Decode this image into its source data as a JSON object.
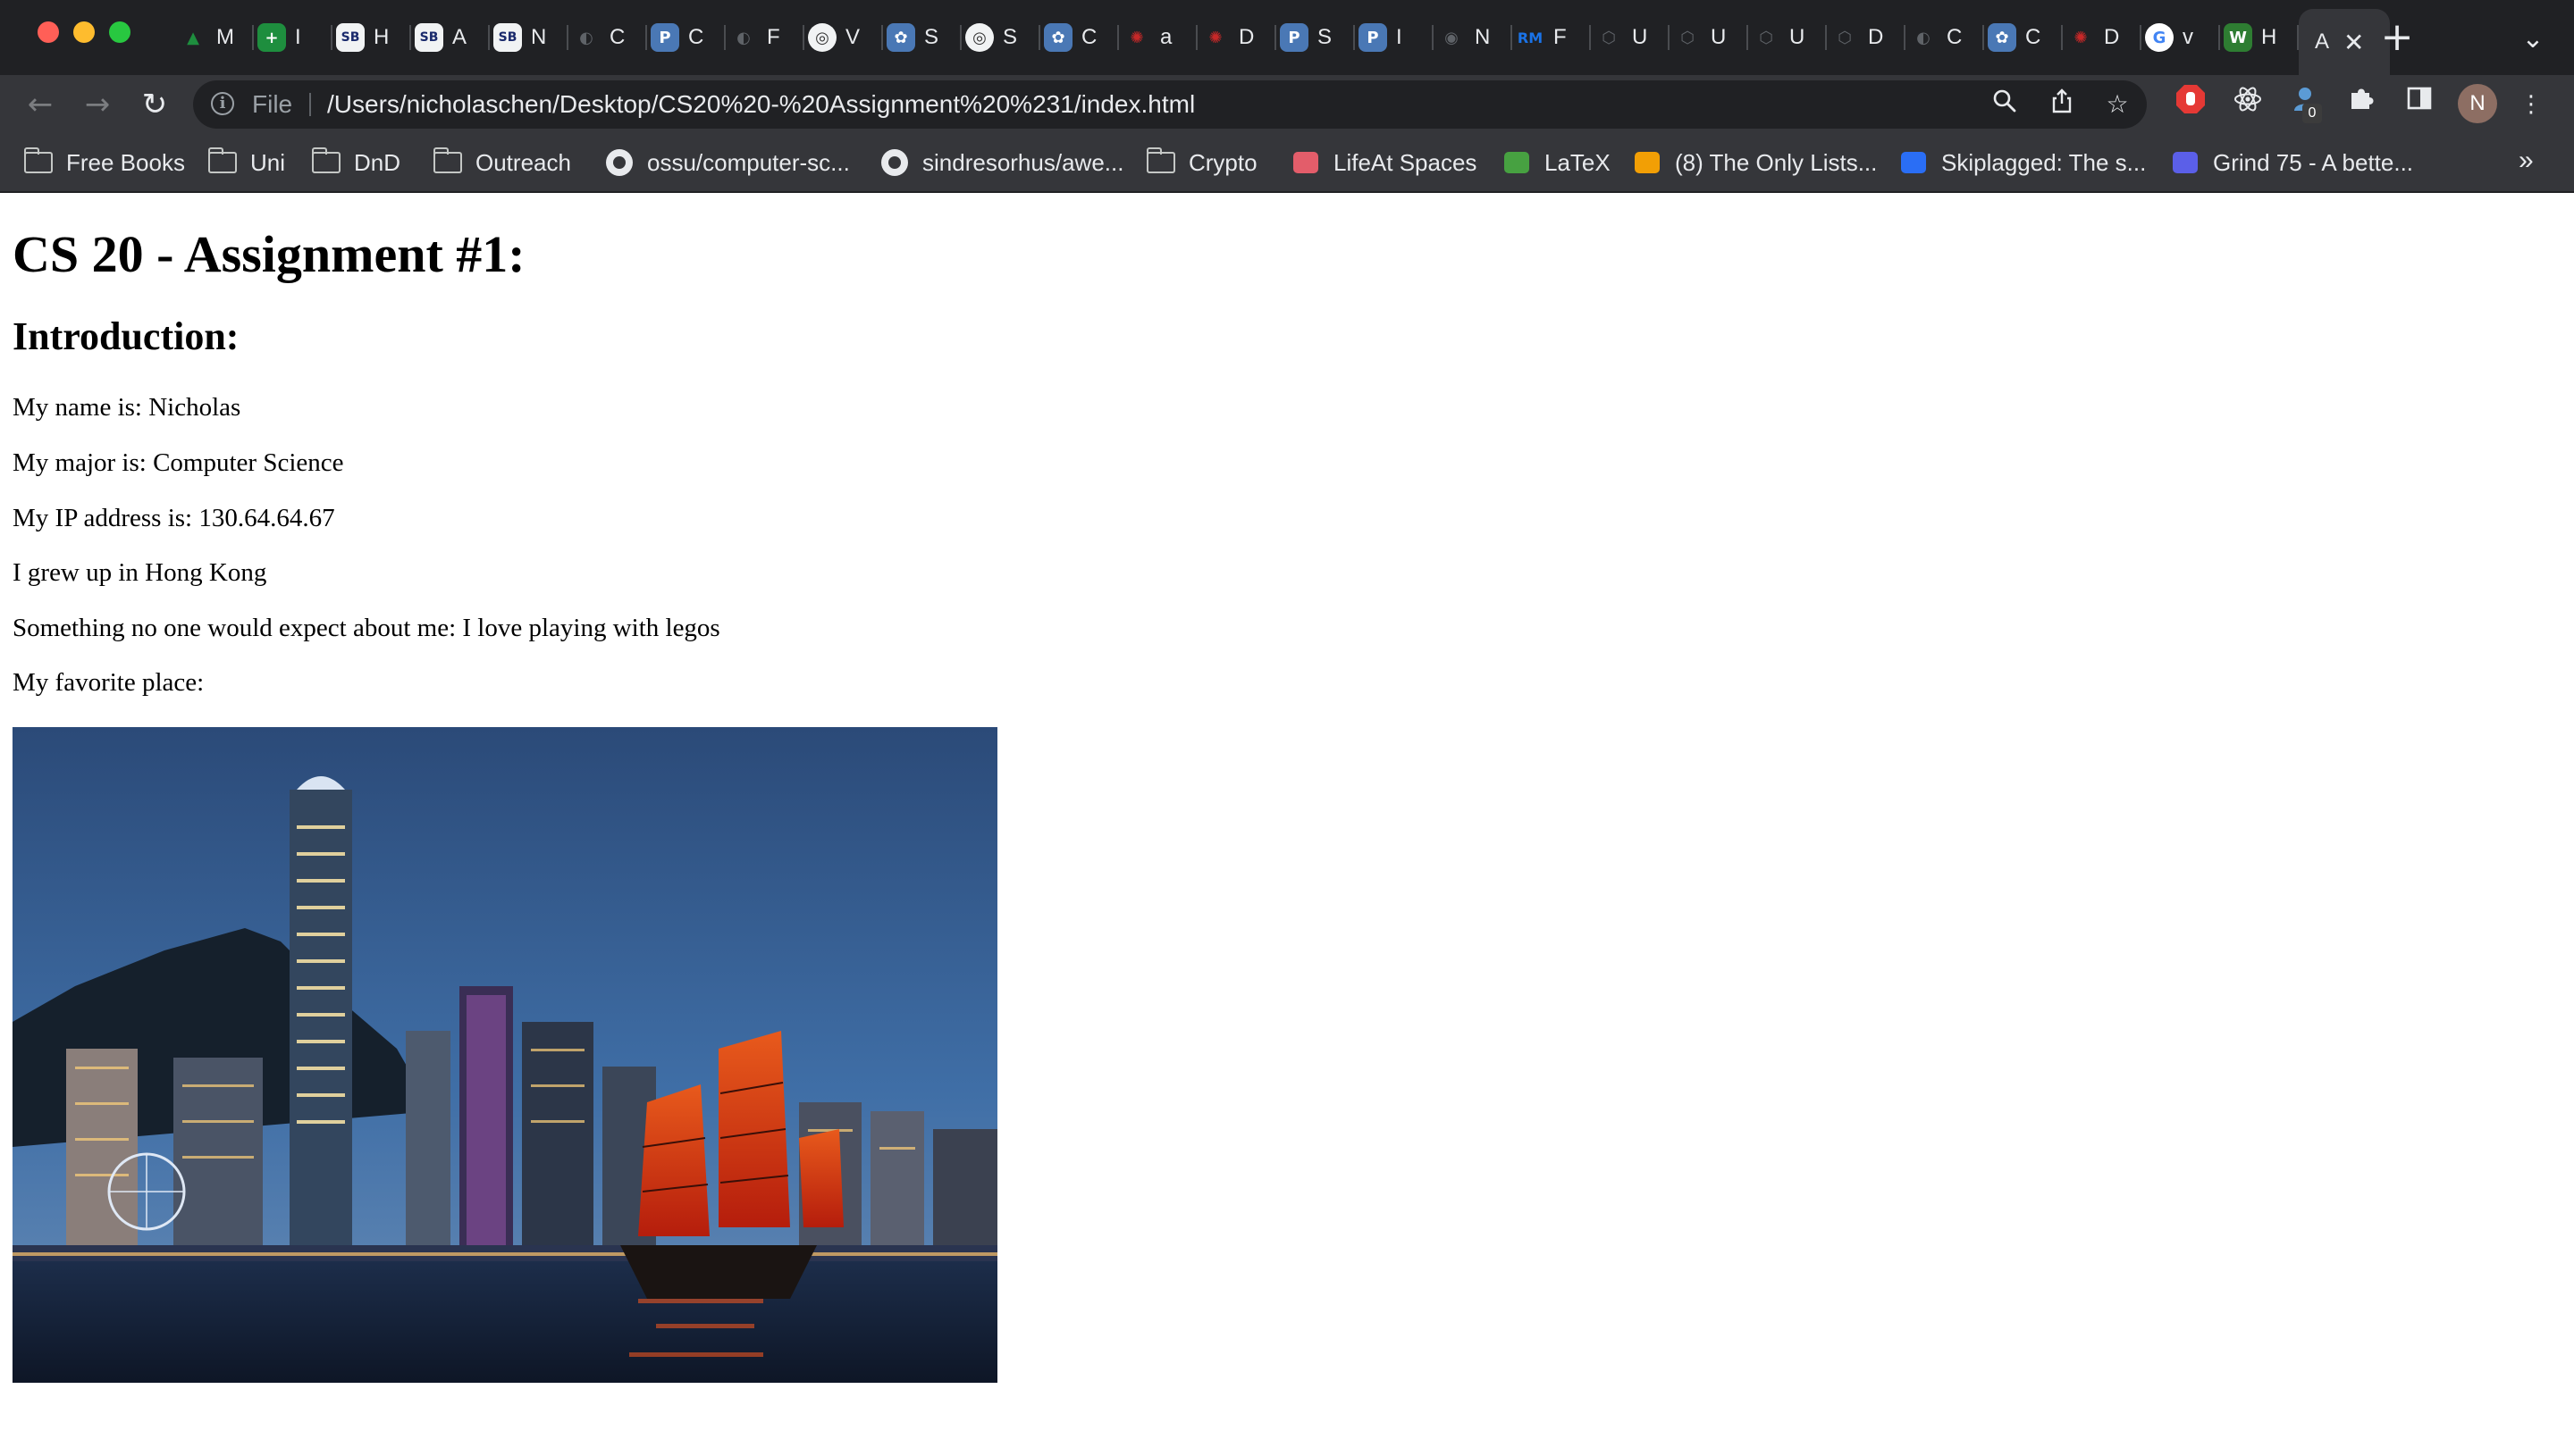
{
  "window": {
    "traffic_lights": [
      "close",
      "minimize",
      "zoom"
    ]
  },
  "tabs": [
    {
      "icon": "google-drive-icon",
      "label": "M",
      "color": "#1e8e3e"
    },
    {
      "icon": "green-plus-icon",
      "label": "I",
      "color": "#1e8e3e"
    },
    {
      "icon": "sb-icon",
      "label": "H",
      "color": "#1a2a6c"
    },
    {
      "icon": "sb-icon",
      "label": "A",
      "color": "#1a2a6c"
    },
    {
      "icon": "sb-icon",
      "label": "N",
      "color": "#1a2a6c"
    },
    {
      "icon": "globe-icon",
      "label": "C",
      "color": "#5f6368"
    },
    {
      "icon": "p-icon",
      "label": "C",
      "color": "#4a78b5"
    },
    {
      "icon": "globe-icon",
      "label": "F",
      "color": "#5f6368"
    },
    {
      "icon": "ring-icon",
      "label": "V",
      "color": "#f1f3f4"
    },
    {
      "icon": "flower-icon",
      "label": "S",
      "color": "#4a78b5"
    },
    {
      "icon": "ring-icon",
      "label": "S",
      "color": "#f1f3f4"
    },
    {
      "icon": "flower-icon",
      "label": "C",
      "color": "#4a78b5"
    },
    {
      "icon": "sun-icon",
      "label": "a",
      "color": "#c62828"
    },
    {
      "icon": "sun-icon",
      "label": "D",
      "color": "#c62828"
    },
    {
      "icon": "p-icon",
      "label": "S",
      "color": "#4a78b5"
    },
    {
      "icon": "p-icon",
      "label": "I",
      "color": "#4a78b5"
    },
    {
      "icon": "chrome-icon",
      "label": "N",
      "color": "#5f6368"
    },
    {
      "icon": "rm-icon",
      "label": "F",
      "color": "#1a73e8"
    },
    {
      "icon": "unity-icon",
      "label": "U",
      "color": "#5f6368"
    },
    {
      "icon": "unity-icon",
      "label": "U",
      "color": "#5f6368"
    },
    {
      "icon": "unity-icon",
      "label": "U",
      "color": "#5f6368"
    },
    {
      "icon": "unity-icon",
      "label": "D",
      "color": "#5f6368"
    },
    {
      "icon": "globe-icon",
      "label": "C",
      "color": "#5f6368"
    },
    {
      "icon": "flower-icon",
      "label": "C",
      "color": "#4a78b5"
    },
    {
      "icon": "sun-icon",
      "label": "D",
      "color": "#c62828"
    },
    {
      "icon": "google-icon",
      "label": "v",
      "color": "#ffffff"
    },
    {
      "icon": "w-icon",
      "label": "H",
      "color": "#2e7d32"
    }
  ],
  "active_tab": {
    "label": "A",
    "close": "✕"
  },
  "new_tab": "+",
  "tab_search": "⌄",
  "toolbar": {
    "back": "←",
    "forward": "→",
    "reload": "↻",
    "scheme": "File",
    "url": "/Users/nicholaschen/Desktop/CS20%20-%20Assignment%20%231/index.html",
    "ext_badge": "0",
    "profile_initial": "N",
    "menu": "⋮"
  },
  "bookmarks": [
    {
      "icon": "folder-icon",
      "label": "Free Books"
    },
    {
      "icon": "folder-icon",
      "label": "Uni"
    },
    {
      "icon": "folder-icon",
      "label": "DnD"
    },
    {
      "icon": "folder-icon",
      "label": "Outreach"
    },
    {
      "icon": "github-icon",
      "label": "ossu/computer-sc..."
    },
    {
      "icon": "github-icon",
      "label": "sindresorhus/awe..."
    },
    {
      "icon": "folder-icon",
      "label": "Crypto"
    },
    {
      "icon": "lifeat-icon",
      "label": "LifeAt Spaces"
    },
    {
      "icon": "overleaf-icon",
      "label": "LaTeX"
    },
    {
      "icon": "lists-icon",
      "label": "(8) The Only Lists..."
    },
    {
      "icon": "skiplagged-icon",
      "label": "Skiplagged: The s..."
    },
    {
      "icon": "grind75-icon",
      "label": "Grind 75 - A bette..."
    }
  ],
  "bookmarks_more": "»",
  "page": {
    "title": "CS 20 - Assignment #1:",
    "subtitle": "Introduction:",
    "lines": [
      "My name is: Nicholas",
      "My major is: Computer Science",
      "My IP address is: 130.64.64.67",
      "I grew up in Hong Kong",
      "Something no one would expect about me: I love playing with legos",
      "My favorite place:"
    ],
    "image_subject": "Hong Kong skyline at dusk with a red-sailed junk boat"
  }
}
